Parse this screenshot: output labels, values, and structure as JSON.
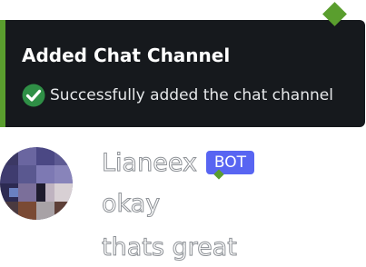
{
  "toast": {
    "title": "Added Chat Channel",
    "message": "Successfully added the chat channel",
    "icon": "check-circle-icon",
    "accent_color": "#5a9e2e",
    "background_color": "#16191d"
  },
  "chat": {
    "message": {
      "author": "Lianeex",
      "badge": "BOT",
      "badge_color": "#5865f2",
      "avatar": "pixelated-avatar",
      "lines": [
        "okay",
        "thats great"
      ]
    }
  }
}
